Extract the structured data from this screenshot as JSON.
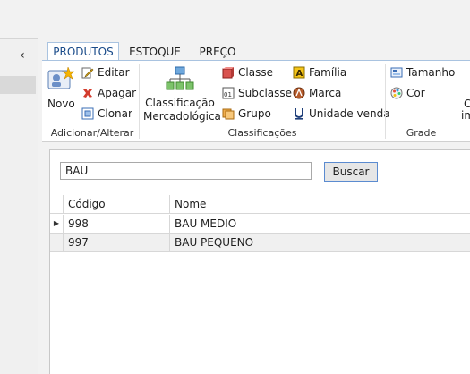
{
  "nav": {
    "collapse_icon": "chevron-left-icon"
  },
  "tabs": [
    {
      "label": "PRODUTOS",
      "active": true
    },
    {
      "label": "ESTOQUE",
      "active": false
    },
    {
      "label": "PREÇO",
      "active": false
    }
  ],
  "ribbon": {
    "groups": {
      "add_edit": "Adicionar/Alterar",
      "classifications": "Classificações",
      "grade": "Grade"
    },
    "buttons": {
      "novo": "Novo",
      "editar": "Editar",
      "apagar": "Apagar",
      "clonar": "Clonar",
      "classificacao_line1": "Classificação",
      "classificacao_line2": "Mercadológica",
      "classe": "Classe",
      "subclasse": "Subclasse",
      "grupo": "Grupo",
      "familia": "Família",
      "marca": "Marca",
      "unidade_venda": "Unidade venda",
      "tamanho": "Tamanho",
      "cor": "Cor",
      "cut_line1": "C",
      "cut_line2": "im"
    }
  },
  "search": {
    "value": "BAU",
    "button": "Buscar"
  },
  "table": {
    "headers": [
      "Código",
      "Nome"
    ],
    "rows": [
      {
        "codigo": "998",
        "nome": "BAU MEDIO",
        "current": true
      },
      {
        "codigo": "997",
        "nome": "BAU PEQUENO",
        "current": false
      }
    ]
  },
  "colors": {
    "accent": "#1b4c8a",
    "tab_border": "#a9c3e0",
    "button_border": "#5b8bd0"
  }
}
